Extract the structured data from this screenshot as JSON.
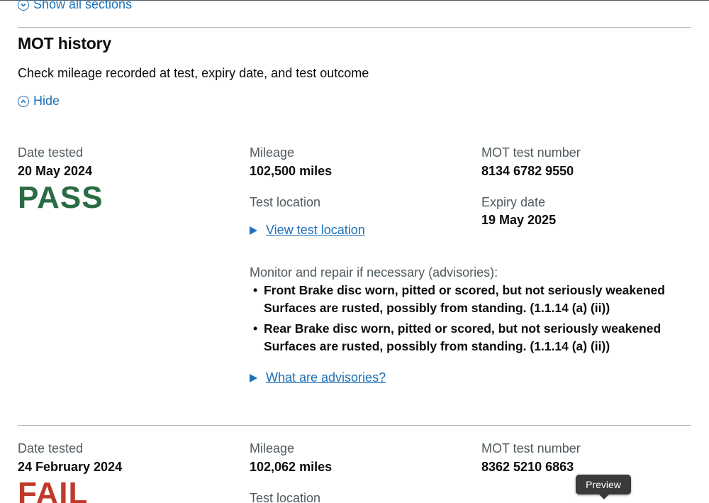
{
  "top_toggle": {
    "label": "Show all sections"
  },
  "section": {
    "title": "MOT history",
    "description": "Check mileage recorded at test, expiry date, and test outcome",
    "hide_label": "Hide"
  },
  "labels": {
    "date_tested": "Date tested",
    "mileage": "Mileage",
    "mot_test_number": "MOT test number",
    "test_location": "Test location",
    "expiry_date": "Expiry date",
    "view_test_location": "View test location",
    "advisories_intro": "Monitor and repair if necessary (advisories):",
    "what_are_advisories": "What are advisories?"
  },
  "tests": [
    {
      "date": "20 May 2024",
      "result": "PASS",
      "mileage": "102,500 miles",
      "test_number": "8134 6782 9550",
      "expiry": "19 May 2025",
      "advisories": [
        "Front Brake disc worn, pitted or scored, but not seriously weakened Surfaces are rusted, possibly from standing. (1.1.14 (a) (ii))",
        "Rear Brake disc worn, pitted or scored, but not seriously weakened Surfaces are rusted, possibly from standing. (1.1.14 (a) (ii))"
      ]
    },
    {
      "date": "24 February 2024",
      "result": "FAIL",
      "mileage": "102,062 miles",
      "test_number": "8362 5210 6863"
    }
  ],
  "tooltip": {
    "label": "Preview"
  },
  "colors": {
    "link": "#1d70b8",
    "pass": "#2a6b44",
    "fail": "#c0392b",
    "secondary_text": "#505a5f"
  }
}
